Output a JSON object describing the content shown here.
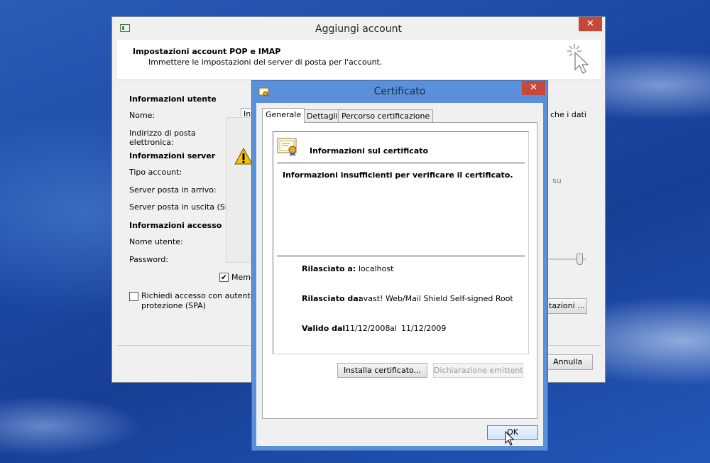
{
  "main_dialog": {
    "title": "Aggiungi account",
    "header_title": "Impostazioni account POP e IMAP",
    "header_subtitle": "Immettere le impostazioni del server di posta per l'account.",
    "section_user": "Informazioni utente",
    "label_name": "Nome:",
    "name_value": "Inf",
    "label_email": "Indirizzo di posta\nelettronica:",
    "section_server": "Informazioni server",
    "label_account_type": "Tipo account:",
    "label_incoming": "Server posta in arrivo:",
    "label_outgoing": "Server posta in uscita (SMT",
    "section_access": "Informazioni accesso",
    "label_username": "Nome utente:",
    "label_password": "Password:",
    "remember_label": "Memo",
    "remember_checked": true,
    "spa_label_1": "Richiedi accesso con autentica",
    "spa_label_2": "protezione (SPA)",
    "spa_checked": false,
    "right_text_1": "che i dati",
    "right_text_2": "su",
    "more_settings_label": "tazioni ...",
    "cancel_label": "Annulla",
    "close_glyph": "✕"
  },
  "cert_dialog": {
    "title": "Certificato",
    "close_glyph": "✕",
    "tabs": [
      "Generale",
      "Dettagli",
      "Percorso certificazione"
    ],
    "info_title": "Informazioni sul certificato",
    "warning": "Informazioni insufficienti per verificare il certificato.",
    "issued_to_label": "Rilasciato a:",
    "issued_to_value": "localhost",
    "issued_by_label": "Rilasciato da:",
    "issued_by_value": "avast! Web/Mail Shield Self-signed Root",
    "valid_label": "Valido dal",
    "valid_from": "11/12/2008",
    "valid_al": "al",
    "valid_to": "11/12/2009",
    "install_label": "Installa certificato...",
    "issuer_statement_label": "Dichiarazione emittente",
    "ok_label": "OK"
  },
  "colors": {
    "close_red": "#c7483a",
    "cert_frame_blue": "#5a8fd9"
  },
  "icons": [
    "window-system-icon",
    "wand-cursor-icon",
    "warning-icon",
    "certificate-icon",
    "mouse-cursor-icon"
  ]
}
